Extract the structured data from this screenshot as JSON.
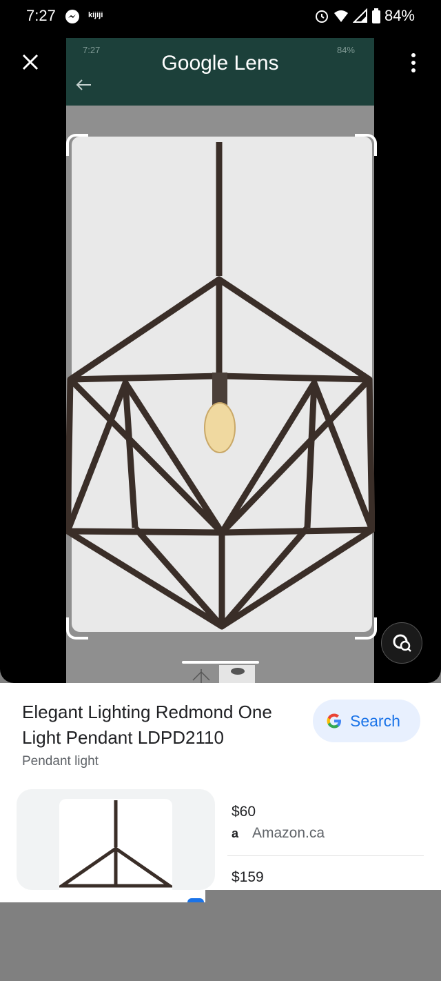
{
  "status_bar": {
    "time": "7:27",
    "app_label": "kijiji",
    "battery": "84%"
  },
  "inner_screenshot": {
    "time": "7:27",
    "battery": "84%",
    "title": "Google Lens"
  },
  "result": {
    "title": "Elegant Lighting Redmond One Light Pendant LDPD2110",
    "subtitle": "Pendant light",
    "search_label": "Search"
  },
  "offers": [
    {
      "price": "$60",
      "store": "Amazon.ca",
      "store_icon": "a"
    },
    {
      "price": "$159"
    }
  ],
  "colors": {
    "accent": "#1a73e8",
    "inner_header": "#1c403a"
  }
}
